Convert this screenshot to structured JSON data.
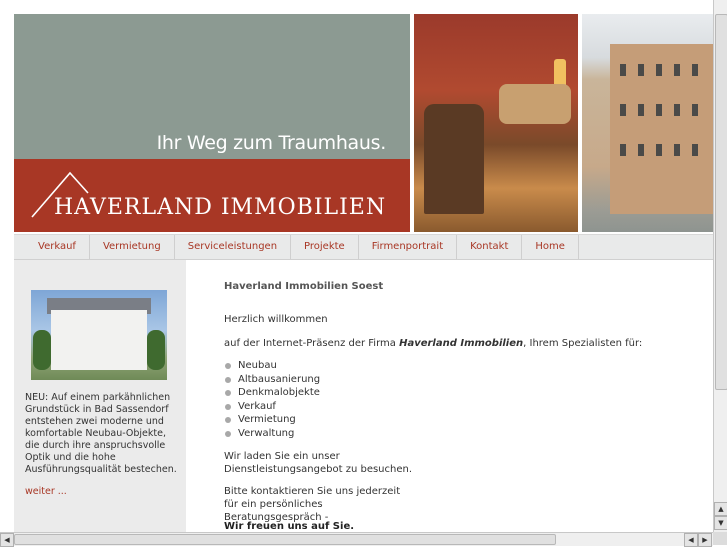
{
  "header": {
    "tagline": "Ihr Weg zum Traumhaus.",
    "brand": "HAVERLAND IMMOBILIEN",
    "colors": {
      "gray": "#8c9a92",
      "red": "#a83725"
    }
  },
  "nav": {
    "items": [
      "Verkauf",
      "Vermietung",
      "Serviceleistungen",
      "Projekte",
      "Firmenportrait",
      "Kontakt",
      "Home"
    ]
  },
  "sidebar": {
    "text": "NEU: Auf einem parkähnlichen Grundstück in Bad Sassendorf entstehen zwei moderne und komfortable Neubau-Objekte, die durch ihre anspruchsvolle Optik und die hohe Ausführungsqualität bestechen.",
    "link": "weiter ..."
  },
  "main": {
    "title": "Haverland Immobilien Soest",
    "greeting": "Herzlich willkommen",
    "intro_prefix": "auf der Internet-Präsenz der Firma ",
    "intro_company": "Haverland Immobilien",
    "intro_suffix": ", Ihrem Spezialisten für:",
    "services": [
      "Neubau",
      "Altbausanierung",
      "Denkmalobjekte",
      "Verkauf",
      "Vermietung",
      "Verwaltung"
    ],
    "invite": "Wir laden Sie ein unser Dienstleistungsangebot zu besuchen.",
    "contact": "Bitte kontaktieren Sie uns jederzeit für ein persönliches Beratungsgespräch -",
    "closing": "Wir freuen uns auf Sie."
  },
  "scrollbars": {
    "up_arrow": "▲",
    "down_arrow": "▼",
    "left_arrow": "◀",
    "right_arrow": "▶"
  }
}
